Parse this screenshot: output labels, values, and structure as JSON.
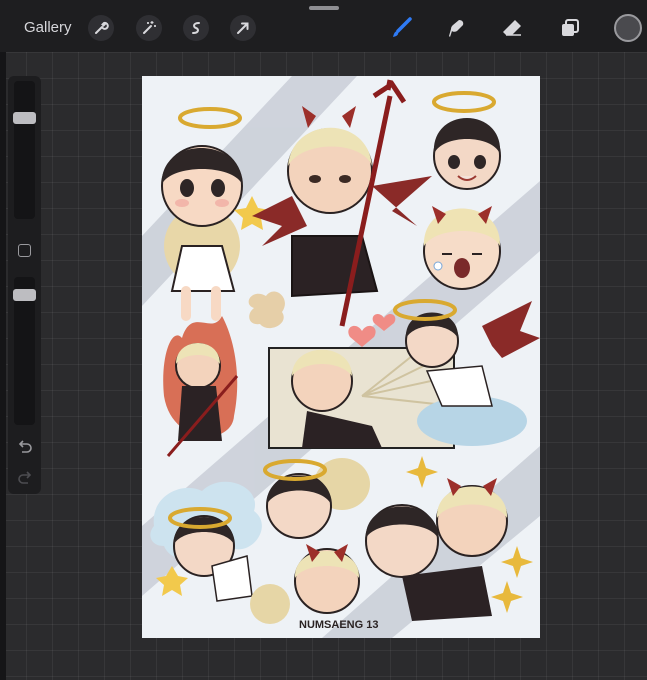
{
  "toolbar": {
    "gallery_label": "Gallery",
    "left_tools": [
      "wrench-icon",
      "magic-wand-icon",
      "selection-icon",
      "transform-arrow-icon"
    ],
    "right_tools": [
      "brush-icon",
      "smudge-icon",
      "eraser-icon",
      "layers-icon",
      "color-icon"
    ],
    "active_tool_color": "#2f7bf5"
  },
  "sidebar": {
    "brush_size_level": 0.1,
    "opacity_level": 0.07
  },
  "canvas": {
    "background": "#eef2f6",
    "stripe_color": "#c5cad3",
    "signature": "NUMSAENG 13"
  }
}
